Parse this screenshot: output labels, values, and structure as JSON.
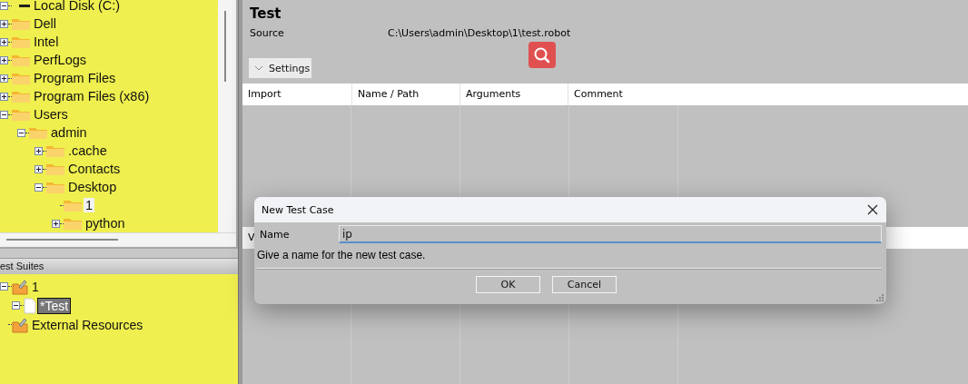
{
  "file_tree": [
    {
      "kind": "drive",
      "label": "Local Disk (C:)",
      "expandable": true,
      "expanded": true,
      "selected": false,
      "children": [
        {
          "kind": "folder",
          "label": "Dell",
          "expandable": true,
          "expanded": false,
          "selected": false
        },
        {
          "kind": "folder",
          "label": "Intel",
          "expandable": true,
          "expanded": false,
          "selected": false
        },
        {
          "kind": "folder",
          "label": "PerfLogs",
          "expandable": true,
          "expanded": false,
          "selected": false
        },
        {
          "kind": "folder",
          "label": "Program Files",
          "expandable": true,
          "expanded": false,
          "selected": false
        },
        {
          "kind": "folder",
          "label": "Program Files (x86)",
          "expandable": true,
          "expanded": false,
          "selected": false
        },
        {
          "kind": "folder",
          "label": "Users",
          "expandable": true,
          "expanded": true,
          "selected": false,
          "children": [
            {
              "kind": "folder",
              "label": "admin",
              "expandable": true,
              "expanded": true,
              "selected": false,
              "children": [
                {
                  "kind": "folder",
                  "label": ".cache",
                  "expandable": true,
                  "expanded": false,
                  "selected": false
                },
                {
                  "kind": "folder",
                  "label": "Contacts",
                  "expandable": true,
                  "expanded": false,
                  "selected": false
                },
                {
                  "kind": "folder",
                  "label": "Desktop",
                  "expandable": true,
                  "expanded": true,
                  "selected": false,
                  "children": [
                    {
                      "kind": "folder",
                      "label": "1",
                      "expandable": false,
                      "selected": true
                    },
                    {
                      "kind": "folder",
                      "label": "python",
                      "expandable": true,
                      "expanded": false,
                      "selected": false
                    }
                  ]
                }
              ]
            }
          ]
        }
      ]
    }
  ],
  "suites_panel": {
    "title": "est Suites",
    "tree": [
      {
        "kind": "suite",
        "label": "1",
        "expandable": true,
        "expanded": true,
        "selected": false,
        "children": [
          {
            "kind": "file",
            "label": "*Test",
            "expandable": true,
            "expanded": true,
            "selected": true
          }
        ]
      },
      {
        "kind": "suite",
        "label": "External Resources",
        "expandable": false,
        "selected": false
      }
    ]
  },
  "editor": {
    "title": "Test",
    "source_label": "Source",
    "source_path": "C:\\Users\\admin\\Desktop\\1\\test.robot",
    "settings_label": "Settings",
    "settings_expanded": true,
    "table": {
      "columns": [
        "Import",
        "Name / Path",
        "Arguments",
        "Comment"
      ]
    },
    "next_section_label": "V"
  },
  "dialog": {
    "title": "New Test Case",
    "name_label": "Name",
    "name_value": "ip",
    "hint": "Give a name for the new test case.",
    "buttons": [
      "OK",
      "Cancel"
    ]
  }
}
